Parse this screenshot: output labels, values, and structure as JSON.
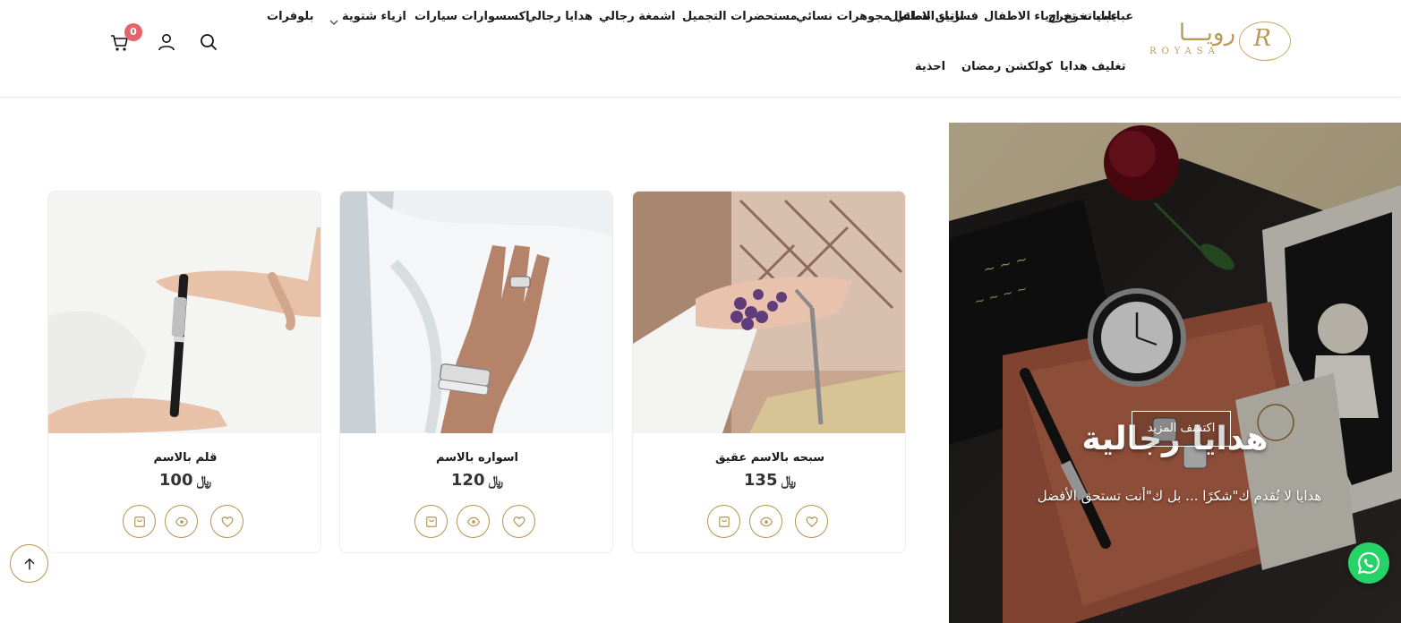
{
  "brand": {
    "name_ar": "رويـــا",
    "name_en": "ROYASA",
    "monogram": "R"
  },
  "nav": {
    "row1": [
      "عبايات تخرج",
      "ازياء الاطفال",
      "فساتين نسائي",
      "مجوهرات نسائي",
      "مستحضرات التجميل",
      "اشمغة رجالي",
      "هدايا رجالي",
      "اكسسوارات سيارات",
      "ازياء شتوية",
      "بلوفرات"
    ],
    "row2": [
      "تغليف هدايا",
      "كولكشن رمضان",
      "احذية"
    ]
  },
  "header_icons": {
    "search": "search-icon",
    "account": "user-icon",
    "cart": "cart-icon",
    "cart_count": "0"
  },
  "hero": {
    "title": "هدايا رجالية",
    "subtitle": "هدايا لا تُقدم ك\"شكرًا ... بل ك\"أنت تستحق الأفضل",
    "button": "اكتشف المزيد"
  },
  "products": [
    {
      "name": "سبحه بالاسم عقيق",
      "price": "135",
      "currency": "﷼"
    },
    {
      "name": "اسواره بالاسم",
      "price": "120",
      "currency": "﷼"
    },
    {
      "name": "قلم بالاسم",
      "price": "100",
      "currency": "﷼"
    }
  ],
  "product_actions": [
    "heart-icon",
    "eye-icon",
    "cart-icon"
  ],
  "colors": {
    "accent": "#b8934e",
    "badge": "#e5646b",
    "whatsapp": "#25d366"
  }
}
